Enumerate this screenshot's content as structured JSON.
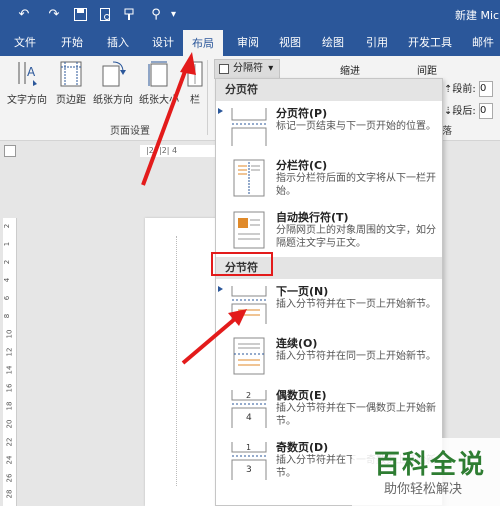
{
  "titlebar": {
    "doc_title": "新建 Micr",
    "icons": [
      "undo-icon",
      "redo-icon",
      "save-icon",
      "print-preview-icon",
      "format-painter-icon",
      "search-icon",
      "customize-icon"
    ]
  },
  "tabs": [
    {
      "label": "文件"
    },
    {
      "label": "开始"
    },
    {
      "label": "插入"
    },
    {
      "label": "设计"
    },
    {
      "label": "布局",
      "active": true
    },
    {
      "label": "审阅"
    },
    {
      "label": "视图"
    },
    {
      "label": "绘图"
    },
    {
      "label": "引用"
    },
    {
      "label": "开发工具"
    },
    {
      "label": "邮件"
    }
  ],
  "ribbon": {
    "buttons": [
      {
        "label": "文字方向",
        "icon": "text-direction-icon"
      },
      {
        "label": "页边距",
        "icon": "margins-icon"
      },
      {
        "label": "纸张方向",
        "icon": "orientation-icon"
      },
      {
        "label": "纸张大小",
        "icon": "paper-size-icon"
      },
      {
        "label": "栏",
        "icon": "columns-icon"
      }
    ],
    "group_page_setup": "页面设置",
    "breaks_label": "分隔符",
    "indent_label": "缩进",
    "spacing_label": "间距",
    "before_label": "段前:",
    "after_label": "段后:",
    "before_value": "0",
    "after_value": "0",
    "group_paragraph": "段落"
  },
  "ruler": {
    "text": "|2|  |2|  4"
  },
  "vruler_ticks": [
    "2",
    "1",
    "2",
    "4",
    "6",
    "8",
    "10",
    "12",
    "14",
    "16",
    "18",
    "20",
    "22",
    "24",
    "26",
    "28"
  ],
  "dropdown": {
    "page_breaks_header": "分页符",
    "section_breaks_header": "分节符",
    "items": [
      {
        "title": "分页符(P)",
        "desc": "标记一页结束与下一页开始的位置。"
      },
      {
        "title": "分栏符(C)",
        "desc": "指示分栏符后面的文字将从下一栏开始。"
      },
      {
        "title": "自动换行符(T)",
        "desc": "分隔网页上的对象周围的文字，如分隔题注文字与正文。"
      },
      {
        "title": "下一页(N)",
        "desc": "插入分节符并在下一页上开始新节。"
      },
      {
        "title": "连续(O)",
        "desc": "插入分节符并在同一页上开始新节。"
      },
      {
        "title": "偶数页(E)",
        "desc": "插入分节符并在下一偶数页上开始新节。"
      },
      {
        "title": "奇数页(D)",
        "desc": "插入分节符并在下一奇数页上开始新节。"
      }
    ]
  },
  "watermark": {
    "logo": "百科全说",
    "sub": "助你轻松解决"
  },
  "colors": {
    "brand": "#2b579a",
    "annotation": "#e31b1b",
    "watermark": "#2e7d32"
  }
}
